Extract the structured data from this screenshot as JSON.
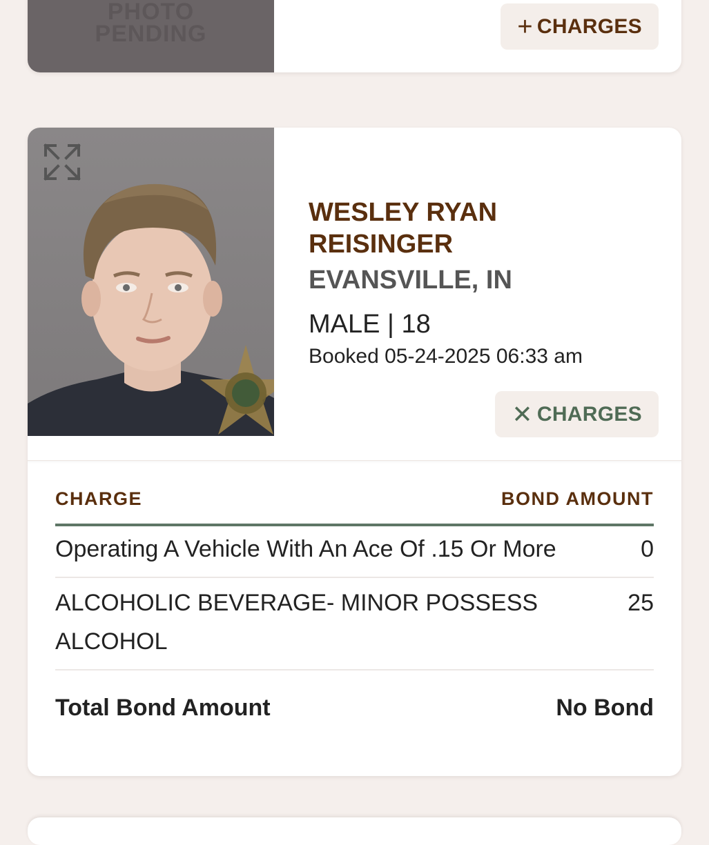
{
  "prev_card": {
    "photo_pending_line1": "PHOTO",
    "photo_pending_line2": "PENDING",
    "charges_button": {
      "glyph": "+",
      "label": "CHARGES"
    }
  },
  "inmate": {
    "name": "WESLEY RYAN REISINGER",
    "location": "EVANSVILLE, IN",
    "sex_age": "MALE | 18",
    "booked": "Booked 05-24-2025 06:33 am",
    "charges_button": {
      "glyph": "✕",
      "label": "CHARGES"
    }
  },
  "charges_table": {
    "headers": {
      "charge": "CHARGE",
      "bond": "BOND AMOUNT"
    },
    "rows": [
      {
        "charge": "Operating A Vehicle With An Ace Of .15 Or More",
        "bond": "0"
      },
      {
        "charge": "ALCOHOLIC BEVERAGE- MINOR POSSESS ALCOHOL",
        "bond": "25"
      }
    ],
    "total": {
      "label": "Total Bond Amount",
      "value": "No Bond"
    }
  },
  "icons": {
    "expand": "expand-icon",
    "badge": "sheriff-badge-icon"
  },
  "colors": {
    "name_brown": "#5a2f0e",
    "green_accent": "#5e7666",
    "page_bg": "#f5efec"
  }
}
